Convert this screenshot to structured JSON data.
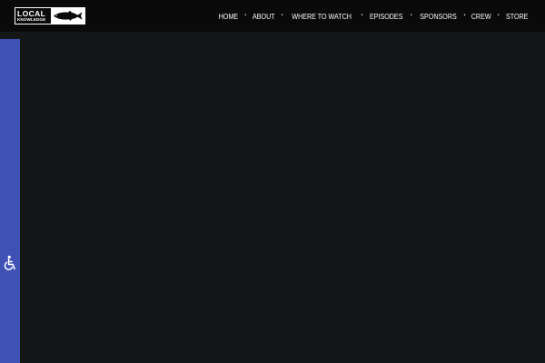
{
  "header": {
    "logo": {
      "line1": "LOCAL",
      "line2": "KNOWLEDGE",
      "icon": "fish-icon"
    },
    "nav": [
      {
        "label": "HOME"
      },
      {
        "label": "ABOUT"
      },
      {
        "label": "WHERE TO WATCH"
      },
      {
        "label": "EPISODES"
      },
      {
        "label": "SPONSORS"
      },
      {
        "label": "CREW"
      },
      {
        "label": "STORE"
      }
    ],
    "nav_separator": "•"
  },
  "accessibility": {
    "icon": "wheelchair-icon"
  },
  "colors": {
    "header_bg": "#0a0a0b",
    "page_bg": "#151618",
    "accessibility_bar": "#3f51b5",
    "text": "#ffffff"
  }
}
